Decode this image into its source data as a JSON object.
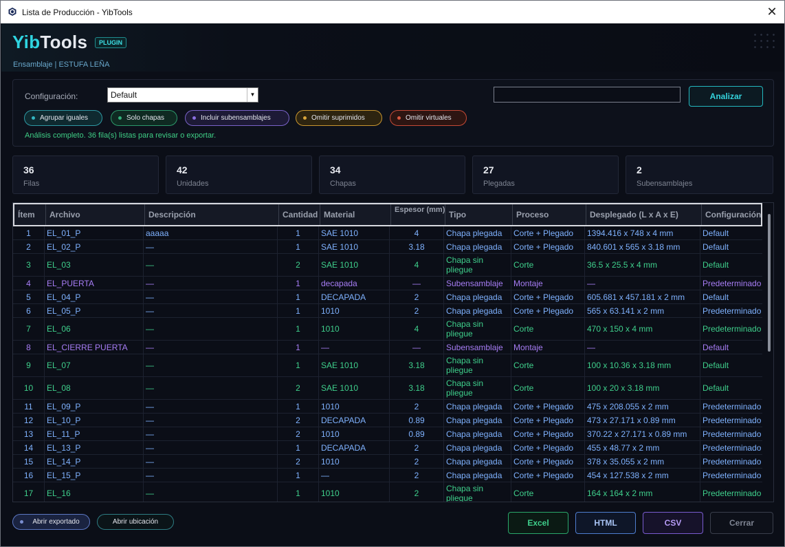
{
  "window": {
    "title": "Lista de Producción - YibTools",
    "close_glyph": "✕"
  },
  "header": {
    "logo_yib": "Yib",
    "logo_tools": "Tools",
    "badge": "PLUGIN",
    "subtitle": "Ensamblaje | ESTUFA LEÑA"
  },
  "config": {
    "label": "Configuración:",
    "selected": "Default",
    "search_value": "",
    "analyze_label": "Analizar",
    "chips": [
      {
        "label": "Agrupar iguales",
        "color": "#33b6c2"
      },
      {
        "label": "Solo chapas",
        "color": "#33b07a"
      },
      {
        "label": "Incluir subensamblajes",
        "color": "#8a6fe0"
      },
      {
        "label": "Omitir suprimidos",
        "color": "#d9a53a"
      },
      {
        "label": "Omitir virtuales",
        "color": "#d4553f"
      }
    ],
    "status": "Análisis completo. 36 fila(s) listas para revisar o exportar."
  },
  "stats": [
    {
      "value": "36",
      "label": "Filas"
    },
    {
      "value": "42",
      "label": "Unidades"
    },
    {
      "value": "34",
      "label": "Chapas"
    },
    {
      "value": "27",
      "label": "Plegadas"
    },
    {
      "value": "2",
      "label": "Subensamblajes"
    }
  ],
  "table": {
    "columns": [
      "Ítem",
      "Archivo",
      "Descripción",
      "Cantidad",
      "Material",
      "Espesor (mm)",
      "Tipo",
      "Proceso",
      "Desplegado (L x A x E)",
      "Configuración"
    ],
    "row_colors": {
      "blue": "#7fb2ff",
      "green": "#3fd08c",
      "purple": "#a77df5"
    },
    "rows": [
      {
        "c": "blue",
        "cells": [
          "1",
          "EL_01_P",
          "aaaaa",
          "1",
          "SAE 1010",
          "4",
          "Chapa plegada",
          "Corte + Plegado",
          "1394.416 x 748 x 4 mm",
          "Default"
        ]
      },
      {
        "c": "blue",
        "cells": [
          "2",
          "EL_02_P",
          "—",
          "1",
          "SAE 1010",
          "3.18",
          "Chapa plegada",
          "Corte + Plegado",
          "840.601 x 565 x 3.18 mm",
          "Default"
        ]
      },
      {
        "c": "green",
        "tall": true,
        "cells": [
          "3",
          "EL_03",
          "—",
          "2",
          "SAE 1010",
          "4",
          "Chapa sin pliegue",
          "Corte",
          "36.5 x 25.5 x 4 mm",
          "Default"
        ]
      },
      {
        "c": "purple",
        "cells": [
          "4",
          "EL_PUERTA",
          "—",
          "1",
          "decapada",
          "—",
          "Subensamblaje",
          "Montaje",
          "—",
          "Predeterminado"
        ]
      },
      {
        "c": "blue",
        "cells": [
          "5",
          "EL_04_P",
          "—",
          "1",
          "DECAPADA",
          "2",
          "Chapa plegada",
          "Corte + Plegado",
          "605.681 x 457.181 x 2 mm",
          "Default"
        ]
      },
      {
        "c": "blue",
        "cells": [
          "6",
          "EL_05_P",
          "—",
          "1",
          "1010",
          "2",
          "Chapa plegada",
          "Corte + Plegado",
          "565 x 63.141 x 2 mm",
          "Predeterminado"
        ]
      },
      {
        "c": "green",
        "tall": true,
        "cells": [
          "7",
          "EL_06",
          "—",
          "1",
          "1010",
          "4",
          "Chapa sin pliegue",
          "Corte",
          "470 x 150 x 4 mm",
          "Predeterminado"
        ]
      },
      {
        "c": "purple",
        "cells": [
          "8",
          "EL_CIERRE PUERTA",
          "—",
          "1",
          "—",
          "—",
          "Subensamblaje",
          "Montaje",
          "—",
          "Default"
        ]
      },
      {
        "c": "green",
        "tall": true,
        "cells": [
          "9",
          "EL_07",
          "—",
          "1",
          "SAE 1010",
          "3.18",
          "Chapa sin pliegue",
          "Corte",
          "100 x 10.36 x 3.18 mm",
          "Default"
        ]
      },
      {
        "c": "green",
        "tall": true,
        "cells": [
          "10",
          "EL_08",
          "—",
          "2",
          "SAE 1010",
          "3.18",
          "Chapa sin pliegue",
          "Corte",
          "100 x 20 x 3.18 mm",
          "Default"
        ]
      },
      {
        "c": "blue",
        "cells": [
          "11",
          "EL_09_P",
          "—",
          "1",
          "1010",
          "2",
          "Chapa plegada",
          "Corte + Plegado",
          "475 x 208.055 x 2 mm",
          "Predeterminado"
        ]
      },
      {
        "c": "blue",
        "cells": [
          "12",
          "EL_10_P",
          "—",
          "2",
          "DECAPADA",
          "0.89",
          "Chapa plegada",
          "Corte + Plegado",
          "473 x 27.171 x 0.89 mm",
          "Predeterminado"
        ]
      },
      {
        "c": "blue",
        "cells": [
          "13",
          "EL_11_P",
          "—",
          "2",
          "1010",
          "0.89",
          "Chapa plegada",
          "Corte + Plegado",
          "370.22 x 27.171 x 0.89 mm",
          "Predeterminado"
        ]
      },
      {
        "c": "blue",
        "cells": [
          "14",
          "EL_13_P",
          "—",
          "1",
          "DECAPADA",
          "2",
          "Chapa plegada",
          "Corte + Plegado",
          "455 x 48.77 x 2 mm",
          "Predeterminado"
        ]
      },
      {
        "c": "blue",
        "cells": [
          "15",
          "EL_14_P",
          "—",
          "2",
          "1010",
          "2",
          "Chapa plegada",
          "Corte + Plegado",
          "378 x 35.055 x 2 mm",
          "Predeterminado"
        ]
      },
      {
        "c": "blue",
        "cells": [
          "16",
          "EL_15_P",
          "—",
          "1",
          "—",
          "2",
          "Chapa plegada",
          "Corte + Plegado",
          "454 x 127.538 x 2 mm",
          "Predeterminado"
        ]
      },
      {
        "c": "green",
        "tall": true,
        "cells": [
          "17",
          "EL_16",
          "—",
          "1",
          "1010",
          "2",
          "Chapa sin pliegue",
          "Corte",
          "164 x 164 x 2 mm",
          "Predeterminado"
        ]
      }
    ]
  },
  "footer": {
    "open_exported": "Abrir exportado",
    "open_location": "Abrir ubicación",
    "excel": "Excel",
    "html": "HTML",
    "csv": "CSV",
    "close": "Cerrar"
  }
}
